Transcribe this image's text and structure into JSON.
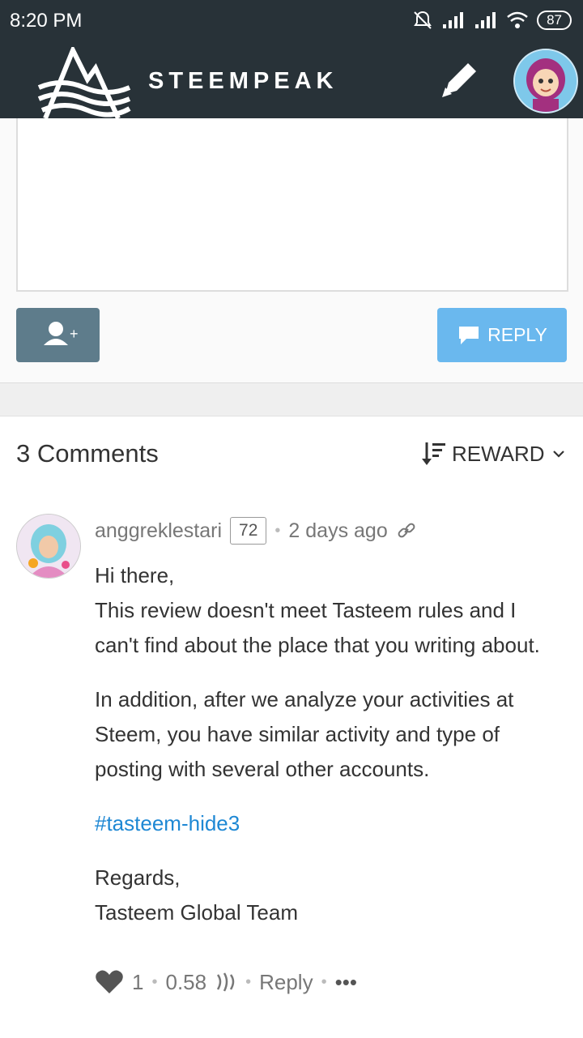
{
  "status_bar": {
    "time": "8:20 PM",
    "battery": "87"
  },
  "app_bar": {
    "brand": "STEEMPEAK"
  },
  "reply_box": {
    "reply_label": "REPLY"
  },
  "comments": {
    "title": "3 Comments",
    "sort_label": "REWARD",
    "items": [
      {
        "author": "anggreklestari",
        "reputation": "72",
        "time": "2 days ago",
        "greeting": "Hi there,",
        "line1": "This review doesn't meet Tasteem rules and I can't find about the place that you writing about.",
        "para2": "In addition, after we analyze your activities at Steem, you have similar activity and type of posting with several other accounts.",
        "hashtag": "#tasteem-hide3",
        "regards": "Regards,",
        "signature": "Tasteem Global Team",
        "votes": "1",
        "payout": "0.58",
        "reply_label": "Reply",
        "more": "•••"
      }
    ]
  },
  "colors": {
    "header": "#283238",
    "reply_button": "#6ab8ee",
    "follow_button": "#5e7c8b",
    "link": "#1e88d4"
  }
}
